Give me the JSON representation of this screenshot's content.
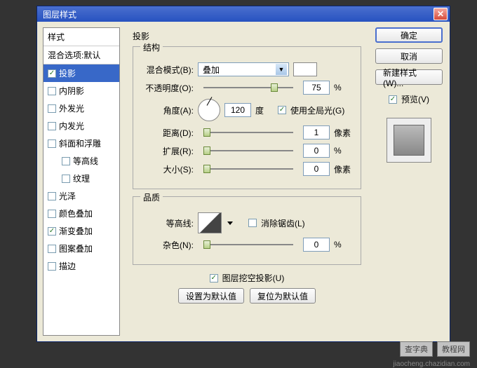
{
  "dialog": {
    "title": "图层样式"
  },
  "styles_panel": {
    "header": "样式",
    "blend": "混合选项:默认",
    "items": [
      {
        "label": "投影",
        "checked": true,
        "selected": true
      },
      {
        "label": "内阴影",
        "checked": false
      },
      {
        "label": "外发光",
        "checked": false
      },
      {
        "label": "内发光",
        "checked": false
      },
      {
        "label": "斜面和浮雕",
        "checked": false
      },
      {
        "label": "等高线",
        "checked": false,
        "sub": true
      },
      {
        "label": "纹理",
        "checked": false,
        "sub": true
      },
      {
        "label": "光泽",
        "checked": false
      },
      {
        "label": "颜色叠加",
        "checked": false
      },
      {
        "label": "渐变叠加",
        "checked": true
      },
      {
        "label": "图案叠加",
        "checked": false
      },
      {
        "label": "描边",
        "checked": false
      }
    ]
  },
  "main": {
    "title": "投影",
    "structure": {
      "title": "结构",
      "blend_mode_label": "混合模式(B):",
      "blend_mode_value": "叠加",
      "opacity_label": "不透明度(O):",
      "opacity_value": "75",
      "opacity_unit": "%",
      "angle_label": "角度(A):",
      "angle_value": "120",
      "angle_unit": "度",
      "global_light_label": "使用全局光(G)",
      "distance_label": "距离(D):",
      "distance_value": "1",
      "distance_unit": "像素",
      "spread_label": "扩展(R):",
      "spread_value": "0",
      "spread_unit": "%",
      "size_label": "大小(S):",
      "size_value": "0",
      "size_unit": "像素"
    },
    "quality": {
      "title": "品质",
      "contour_label": "等高线:",
      "antialias_label": "消除锯齿(L)",
      "noise_label": "杂色(N):",
      "noise_value": "0",
      "noise_unit": "%"
    },
    "knockout_label": "图层挖空投影(U)",
    "default_btn": "设置为默认值",
    "reset_btn": "复位为默认值"
  },
  "right": {
    "ok": "确定",
    "cancel": "取消",
    "new_style": "新建样式(W)...",
    "preview_label": "预览(V)"
  },
  "watermark": {
    "a": "查字典",
    "b": "教程网",
    "c": "jiaocheng.chazidian.com"
  }
}
